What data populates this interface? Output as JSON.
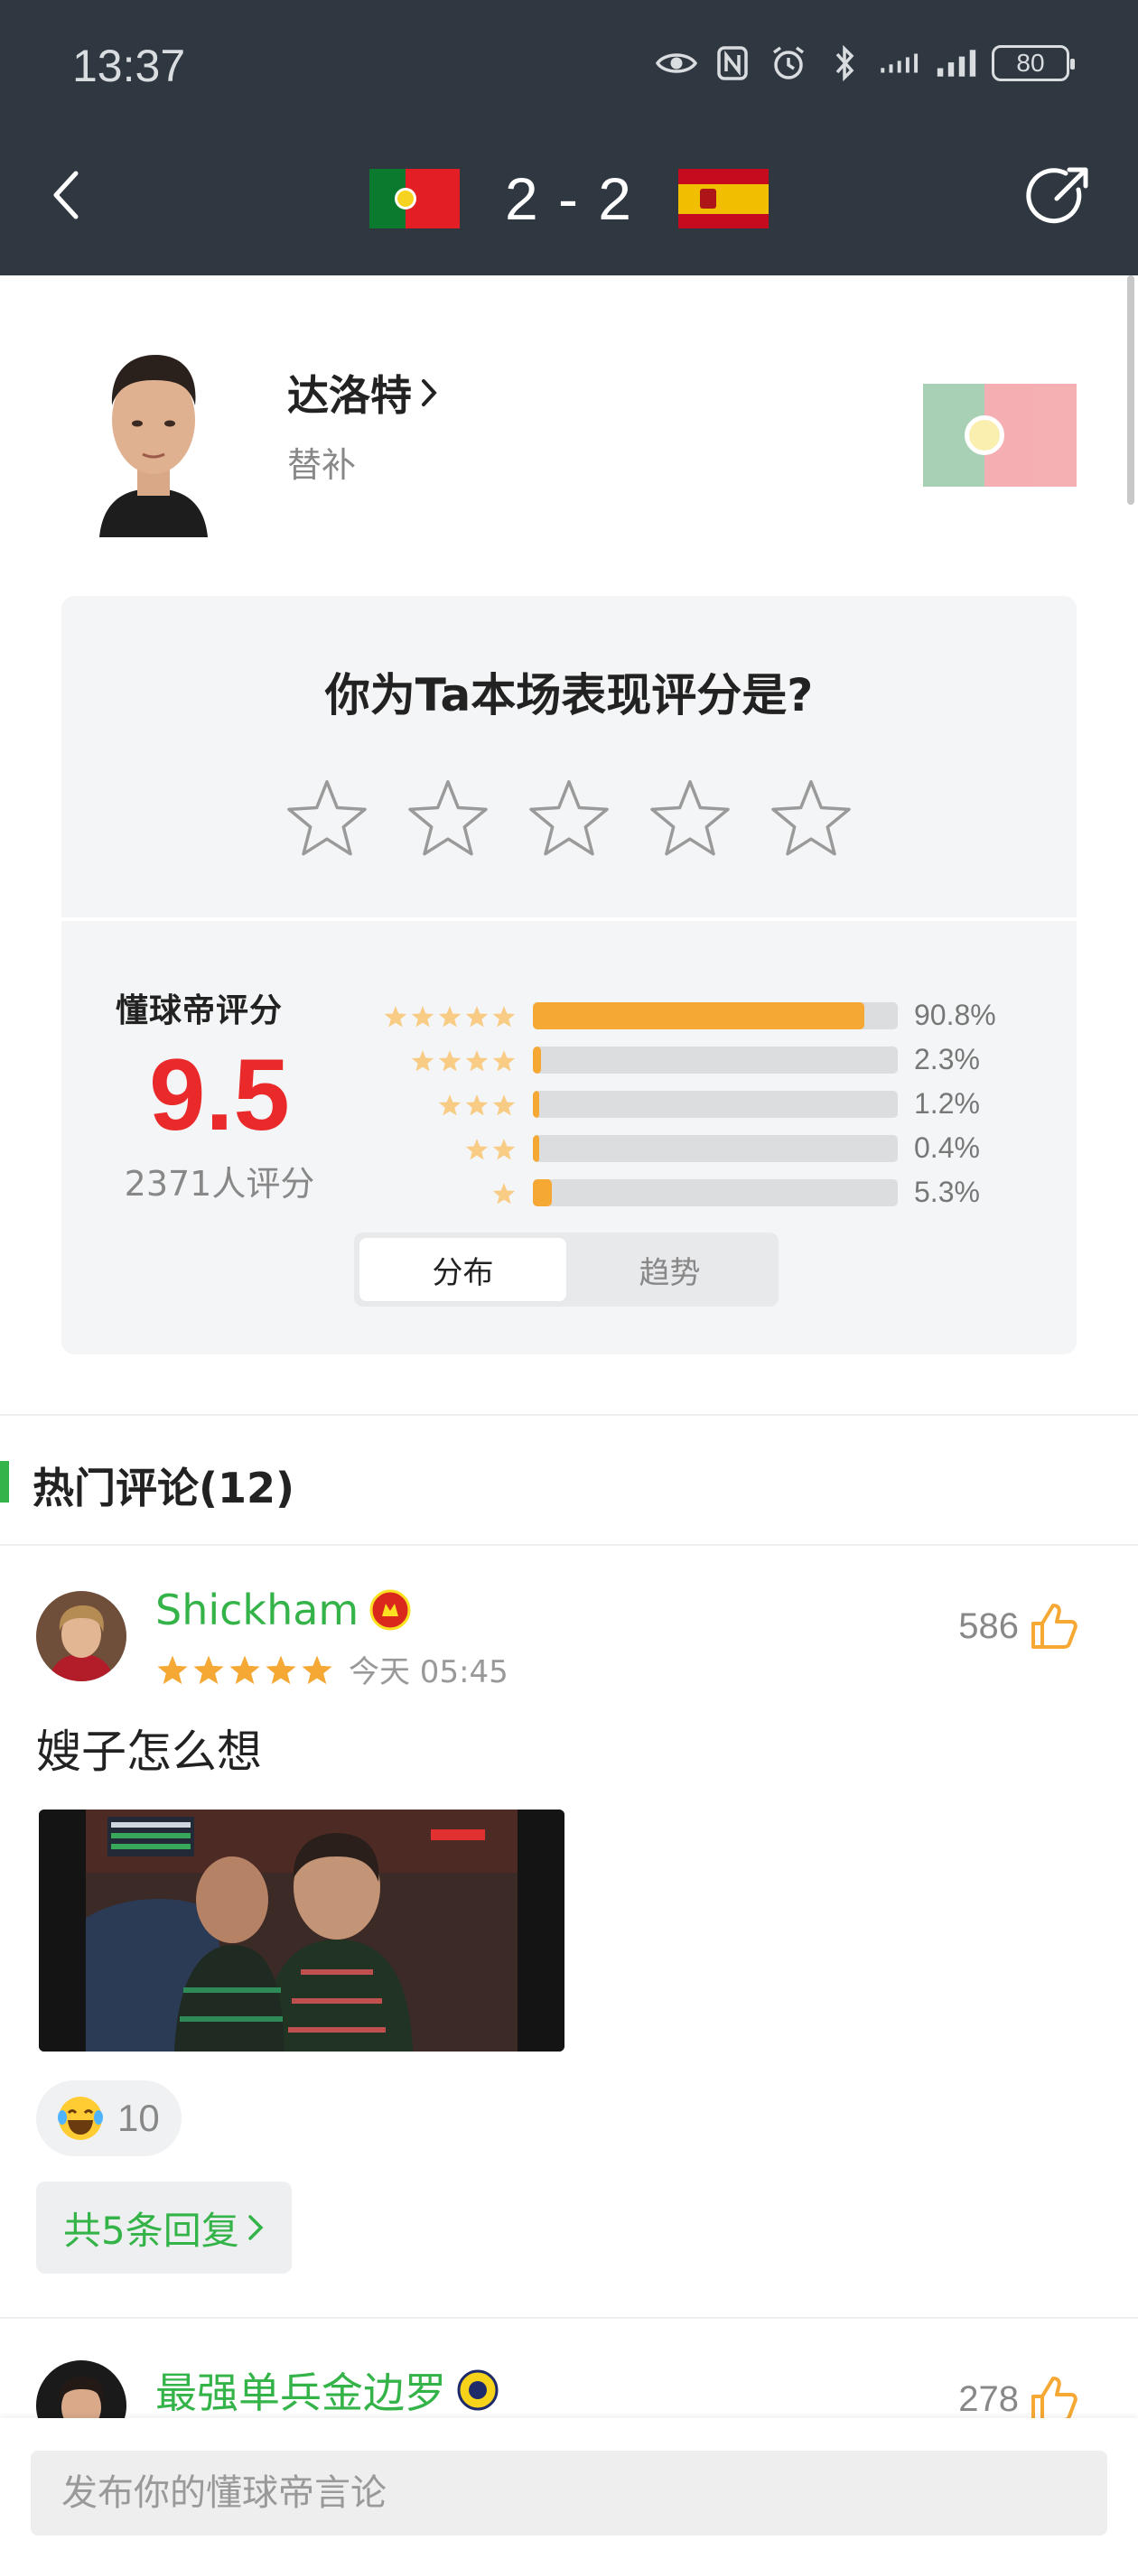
{
  "status_bar": {
    "time": "13:37",
    "battery": "80"
  },
  "match": {
    "score": "2 - 2",
    "home_team": "Portugal",
    "away_team": "Spain"
  },
  "player": {
    "name": "达洛特",
    "role": "替补"
  },
  "rating_prompt": {
    "question": "你为Ta本场表现评分是?",
    "star_count": 5
  },
  "rating_summary": {
    "brand": "懂球帝评分",
    "score": "9.5",
    "raters": "2371人评分",
    "distribution": [
      {
        "stars": 5,
        "percent": 90.8,
        "label": "90.8%"
      },
      {
        "stars": 4,
        "percent": 2.3,
        "label": "2.3%"
      },
      {
        "stars": 3,
        "percent": 1.2,
        "label": "1.2%"
      },
      {
        "stars": 2,
        "percent": 0.4,
        "label": "0.4%"
      },
      {
        "stars": 1,
        "percent": 5.3,
        "label": "5.3%"
      }
    ],
    "tabs": {
      "distribution": "分布",
      "trend": "趋势",
      "active": "distribution"
    }
  },
  "hot_comments": {
    "title": "热门评论(12)",
    "items": [
      {
        "user": "Shickham",
        "team_badge": "manchester-united-badge-icon",
        "rating": 5,
        "time": "今天 05:45",
        "likes": "586",
        "text": "嫂子怎么想",
        "reaction": {
          "emoji": "laughing-tears-emoji",
          "count": "10"
        },
        "replies": "共5条回复"
      },
      {
        "user": "最强单兵金边罗",
        "team_badge": "al-nassr-badge-icon",
        "likes": "278"
      }
    ]
  },
  "composer": {
    "placeholder": "发布你的懂球帝言论"
  },
  "colors": {
    "header_bg": "#2f3840",
    "accent_green": "#34b349",
    "score_red": "#ea2a2a",
    "bar_orange": "#f5a833"
  }
}
